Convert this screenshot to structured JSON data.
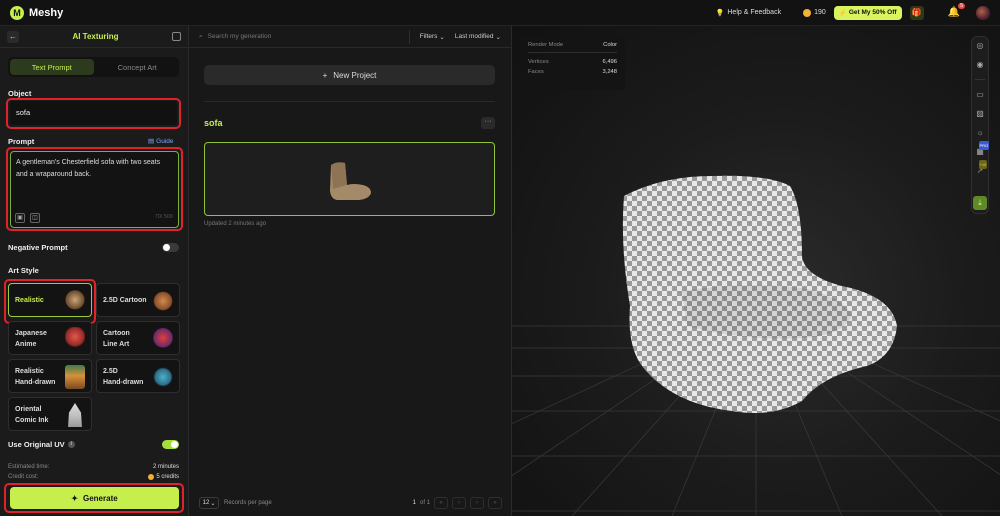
{
  "topbar": {
    "brand": "Meshy",
    "help": "Help & Feedback",
    "credits": "190",
    "promo": "Get My 50% Off",
    "notifications": "5"
  },
  "left": {
    "title": "AI Texturing",
    "tabs": [
      "Text Prompt",
      "Concept Art"
    ],
    "object_label": "Object",
    "object_value": "sofa",
    "prompt_label": "Prompt",
    "guide": "Guide",
    "prompt_value": "A gentleman's Chesterfield sofa with two seats and a wraparound back.",
    "char_count": "70/ 500",
    "negative_prompt": "Negative Prompt",
    "art_style": "Art Style",
    "styles": [
      {
        "line1": "Realistic",
        "line2": ""
      },
      {
        "line1": "2.5D Cartoon",
        "line2": ""
      },
      {
        "line1": "Japanese",
        "line2": "Anime"
      },
      {
        "line1": "Cartoon",
        "line2": "Line Art"
      },
      {
        "line1": "Realistic",
        "line2": "Hand-drawn"
      },
      {
        "line1": "2.5D",
        "line2": "Hand-drawn"
      },
      {
        "line1": "Oriental",
        "line2": "Comic Ink"
      }
    ],
    "use_uv": "Use Original UV",
    "estimated_label": "Estimated time:",
    "estimated_value": "2 minutes",
    "credit_label": "Credit cost:",
    "credit_value": "5 credits",
    "generate": "Generate"
  },
  "mid": {
    "search_placeholder": "Search my generation",
    "filters": "Filters",
    "sort": "Last modified",
    "new_project": "New Project",
    "project_name": "sofa",
    "updated": "Updated 2 minutes ago",
    "records_per_page": "12",
    "records_label": "Records per page",
    "page": "1",
    "of": "of 1"
  },
  "viewport": {
    "render_mode_label": "Render Mode",
    "render_mode_value": "Color",
    "vertices_label": "Vertices",
    "vertices_value": "6,496",
    "faces_label": "Faces",
    "faces_value": "3,248",
    "pro_tag": "PRO",
    "credit_tag": "+10"
  },
  "colors": {
    "accent": "#c6ef4d",
    "highlight": "#e0222a"
  }
}
